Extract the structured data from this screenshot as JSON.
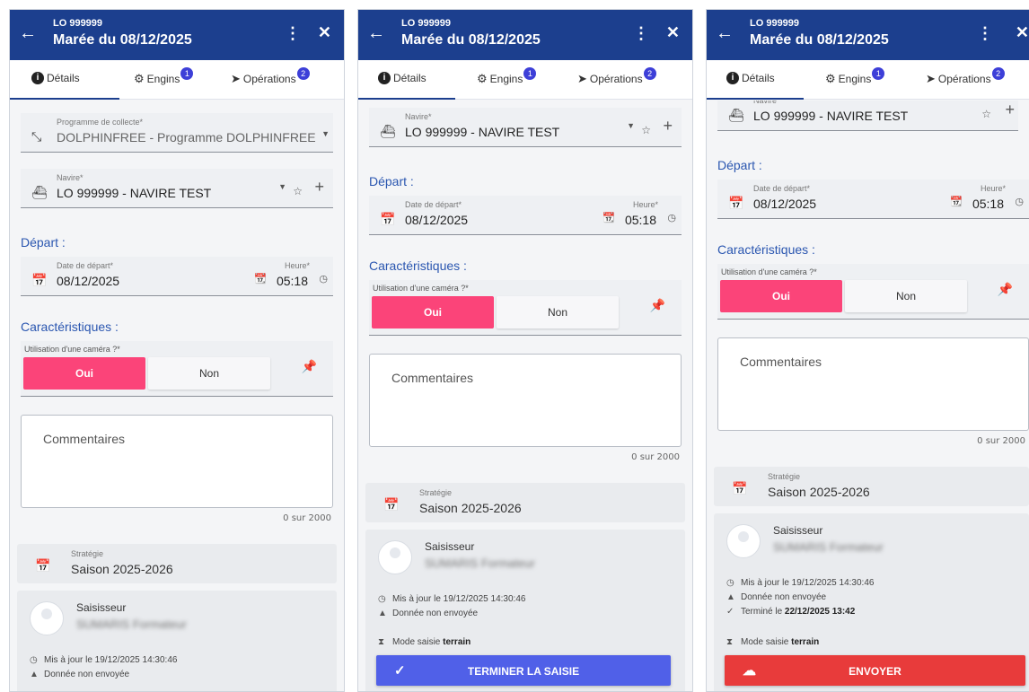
{
  "header": {
    "back_icon": "←",
    "vessel_code": "LO 999999",
    "trip_title": "Marée du 08/12/2025",
    "menu_icon": "⋮",
    "close_icon": "✕",
    "color": "#1c3f8e"
  },
  "tabs": [
    {
      "label": "Détails",
      "icon": "info-icon",
      "badge": ""
    },
    {
      "label": "Engins",
      "icon": "gears-icon",
      "badge": "1"
    },
    {
      "label": "Opérations",
      "icon": "navigation-arrow-icon",
      "badge": "2"
    }
  ],
  "form": {
    "program_label": "Programme de collecte*",
    "program_value": "DOLPHINFREE - Programme DOLPHINFREE",
    "vessel_label": "Navire*",
    "vessel_value": "LO 999999 - NAVIRE TEST",
    "departure_section": "Départ :",
    "date_label": "Date de départ*",
    "date_value": "08/12/2025",
    "time_label": "Heure*",
    "time_value": "05:18",
    "characteristics_section": "Caractéristiques :",
    "camera_label": "Utilisation d'une caméra ?*",
    "camera_yes": "Oui",
    "camera_no": "Non",
    "comments_placeholder": "Commentaires",
    "comments_counter": "0 sur 2000",
    "strategy_label": "Stratégie",
    "strategy_value": "Saison 2025-2026"
  },
  "record": {
    "author_label": "Saisisseur",
    "author_name": "SUMARIS Formateur",
    "updated": "Mis à jour le 19/12/2025 14:30:46",
    "not_sent": "Donnée non envoyée",
    "finished_prefix": "Terminé le ",
    "finished_date": "22/12/2025 13:42",
    "mode_prefix": "Mode saisie ",
    "mode_value": "terrain"
  },
  "buttons": {
    "finish": "TERMINER LA SAISIE",
    "send": "ENVOYER"
  },
  "colors": {
    "accent": "#1c3f8e",
    "yes_selected": "#fb4479",
    "finish_button": "#5060e8",
    "send_button": "#e83b3b",
    "badge": "#3d3fd8",
    "section_title": "#2a56b0"
  }
}
